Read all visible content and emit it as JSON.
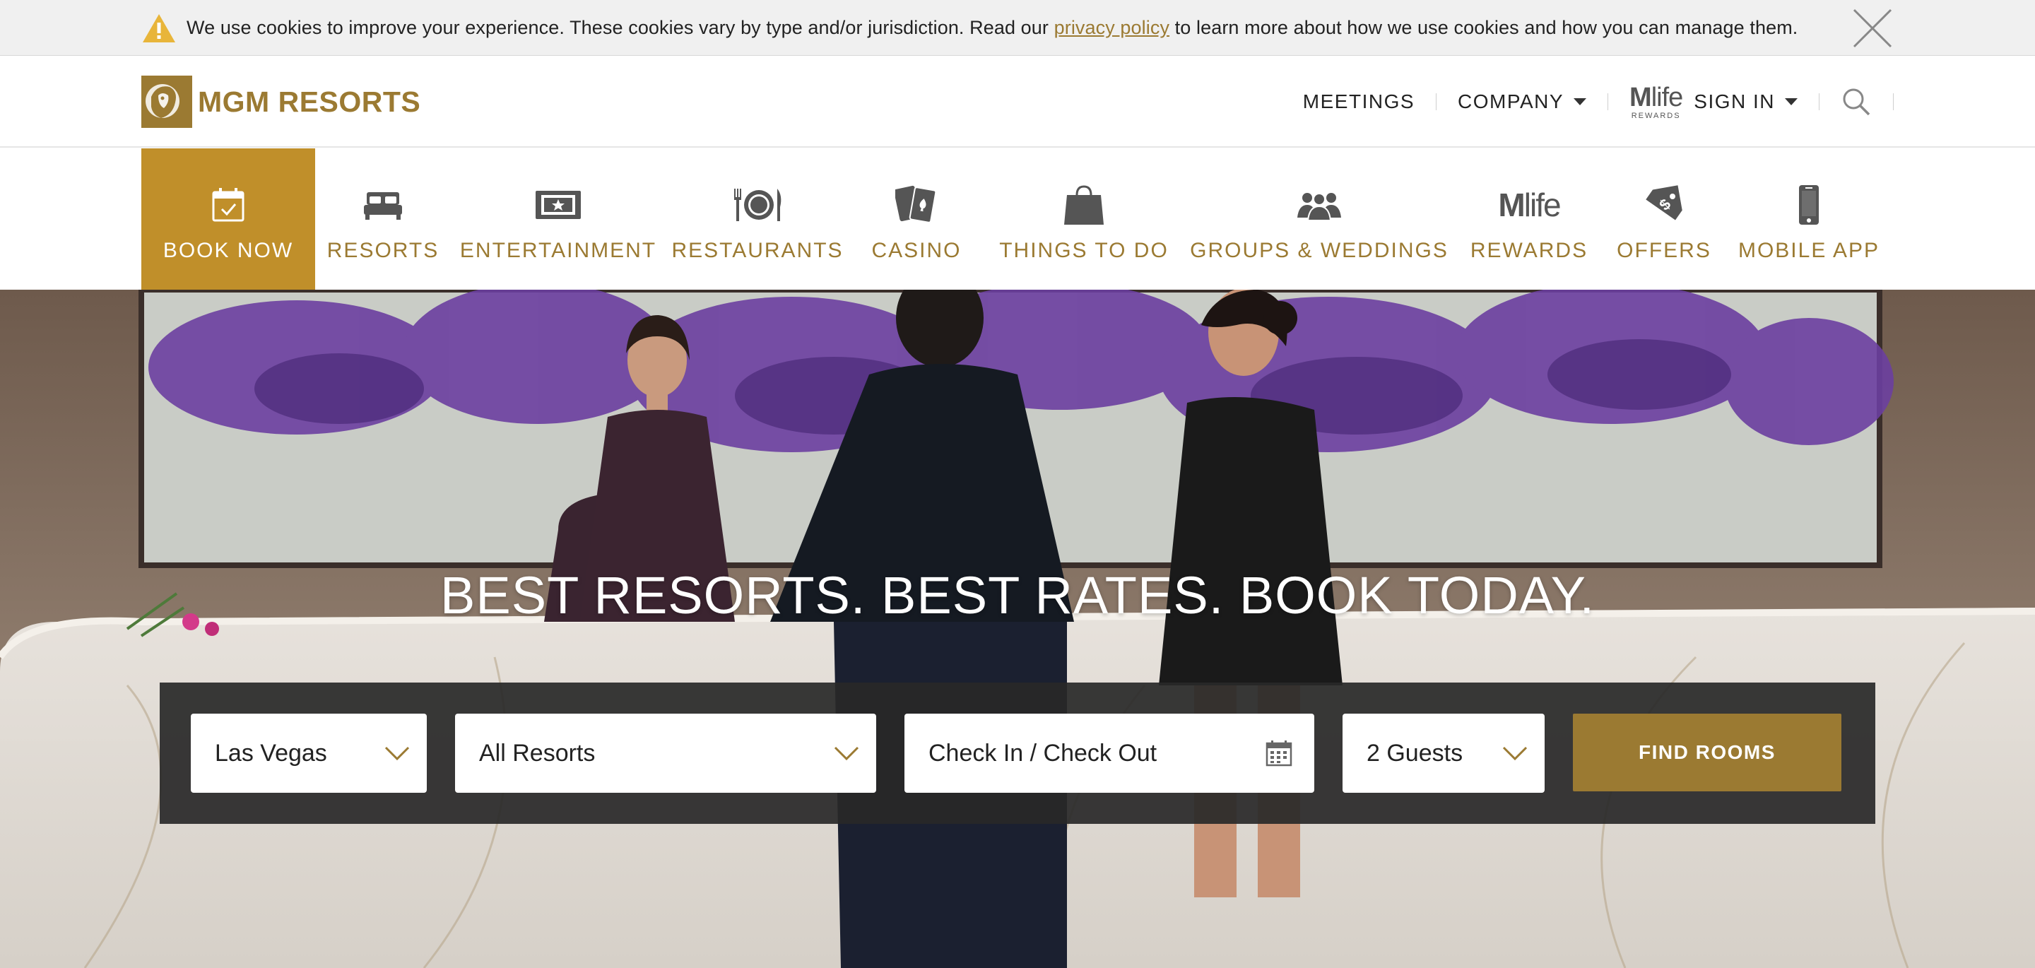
{
  "cookie_banner": {
    "text_before": "We use cookies to improve your experience. These cookies vary by type and/or jurisdiction. Read our ",
    "link_text": "privacy policy",
    "text_after": " to learn more about how we use cookies and how you can manage them."
  },
  "header": {
    "logo_text": "MGM RESORTS",
    "meetings": "MEETINGS",
    "company": "COMPANY",
    "mlife_m": "M",
    "mlife_life": "life",
    "mlife_rewards": "REWARDS",
    "sign_in": "SIGN IN"
  },
  "nav": {
    "items": [
      {
        "label": "BOOK NOW",
        "icon": "calendar-check-icon"
      },
      {
        "label": "RESORTS",
        "icon": "bed-icon"
      },
      {
        "label": "ENTERTAINMENT",
        "icon": "ticket-icon"
      },
      {
        "label": "RESTAURANTS",
        "icon": "plate-cutlery-icon"
      },
      {
        "label": "CASINO",
        "icon": "playing-cards-icon"
      },
      {
        "label": "THINGS TO DO",
        "icon": "shopping-bag-icon"
      },
      {
        "label": "GROUPS & WEDDINGS",
        "icon": "group-icon"
      },
      {
        "label": "REWARDS",
        "icon": "mlife-icon"
      },
      {
        "label": "OFFERS",
        "icon": "price-tag-icon"
      },
      {
        "label": "MOBILE APP",
        "icon": "mobile-phone-icon"
      }
    ],
    "mlife_icon_m": "M",
    "mlife_icon_life": "life"
  },
  "hero": {
    "title": "BEST RESORTS. BEST RATES. BOOK TODAY."
  },
  "booking": {
    "city": "Las Vegas",
    "resort": "All Resorts",
    "dates": "Check In / Check Out",
    "guests": "2 Guests",
    "find_button": "FIND ROOMS"
  },
  "colors": {
    "gold": "#9b7a32",
    "active_gold": "#c08f2a",
    "booking_bar": "#282828",
    "warning": "#e8b53a"
  }
}
